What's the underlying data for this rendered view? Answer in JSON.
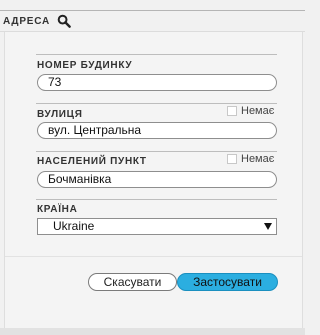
{
  "header": {
    "title": "АДРЕСА",
    "search_icon": "search-icon"
  },
  "house": {
    "label": "НОМЕР БУДИНКУ",
    "value": "73"
  },
  "street": {
    "label": "ВУЛИЦЯ",
    "value": "вул. Центральна",
    "none_label": "Немає",
    "none_checked": false
  },
  "settlement": {
    "label": "НАСЕЛЕНИЙ ПУНКТ",
    "value": "Бочманівка",
    "none_label": "Немає",
    "none_checked": false
  },
  "country": {
    "label": "КРАЇНА",
    "selected": "Ukraine"
  },
  "buttons": {
    "cancel": "Скасувати",
    "apply": "Застосувати"
  },
  "colors": {
    "apply_button": "#2baee0",
    "background": "#f1f1f1"
  }
}
